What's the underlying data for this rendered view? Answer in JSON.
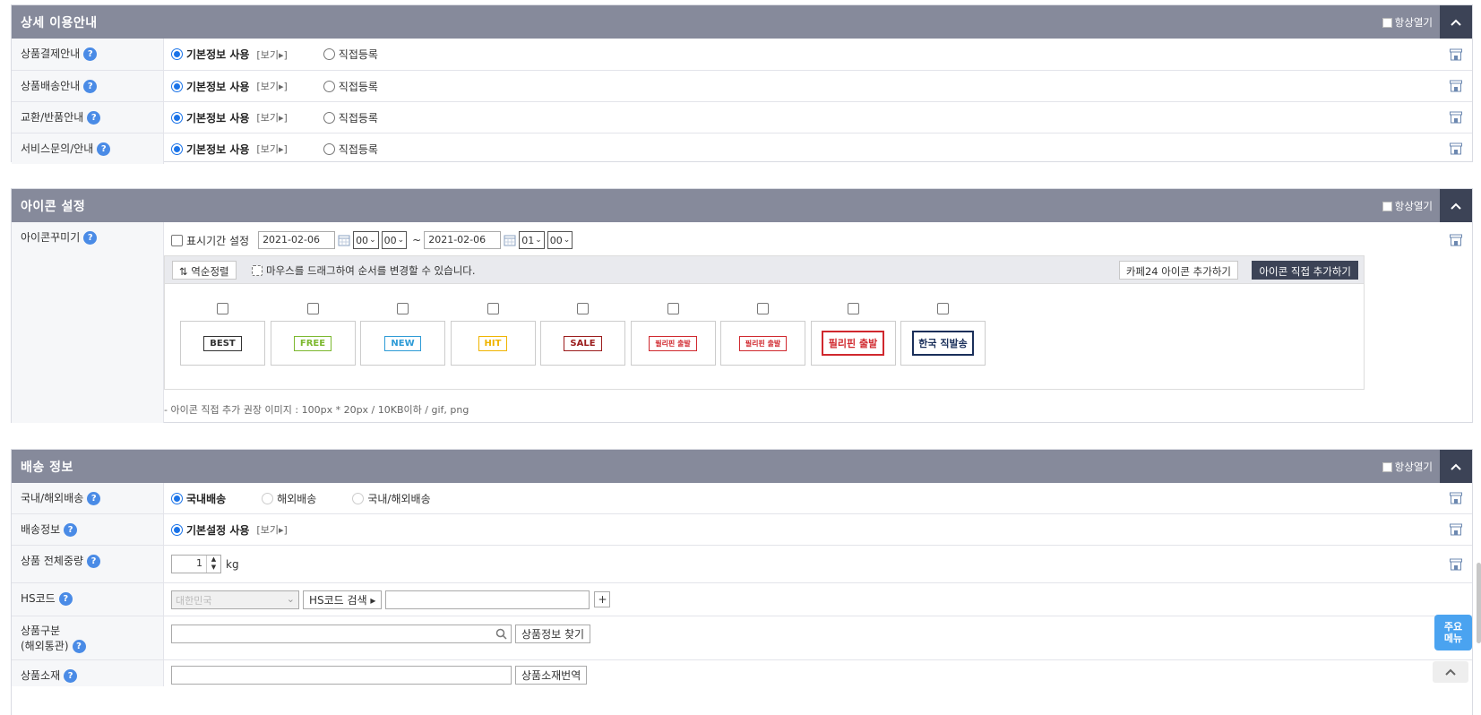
{
  "sections": {
    "detail": {
      "title": "상세 이용안내",
      "always_open": "항상열기",
      "rows": [
        {
          "label": "상품결제안내",
          "option_default": "기본정보 사용",
          "view": "[보기▸]",
          "option_custom": "직접등록"
        },
        {
          "label": "상품배송안내",
          "option_default": "기본정보 사용",
          "view": "[보기▸]",
          "option_custom": "직접등록"
        },
        {
          "label": "교환/반품안내",
          "option_default": "기본정보 사용",
          "view": "[보기▸]",
          "option_custom": "직접등록"
        },
        {
          "label": "서비스문의/안내",
          "option_default": "기본정보 사용",
          "view": "[보기▸]",
          "option_custom": "직접등록"
        }
      ]
    },
    "icon": {
      "title": "아이콘 설정",
      "always_open": "항상열기",
      "label": "아이콘꾸미기",
      "period_label": "표시기간 설정",
      "start_date": "2021-02-06",
      "start_hour": "00",
      "start_min": "00",
      "tilde": "~",
      "end_date": "2021-02-06",
      "end_hour": "01",
      "end_min": "00",
      "reverse_sort": "역순정렬",
      "drag_hint": "마우스를 드래그하여 순서를 변경할 수 있습니다.",
      "add_cafe24": "카페24 아이콘 추가하기",
      "add_direct": "아이콘 직접 추가하기",
      "icons": [
        {
          "text": "BEST",
          "color": "#333333"
        },
        {
          "text": "FREE",
          "color": "#7cb82f"
        },
        {
          "text": "NEW",
          "color": "#2e9bd6"
        },
        {
          "text": "HIT",
          "color": "#f0b400"
        },
        {
          "text": "SALE",
          "color": "#9b1c1c"
        },
        {
          "text": "필리핀 출발",
          "color": "#d0282e"
        },
        {
          "text": "필리핀 출발",
          "color": "#d0282e"
        },
        {
          "text": "필리핀 출발",
          "color": "#d0282e"
        },
        {
          "text": "한국 직발송",
          "color": "#1a2f5a"
        }
      ],
      "note": "- 아이콘 직접 추가 권장 이미지 : 100px * 20px / 10KB이하 / gif, png"
    },
    "shipping": {
      "title": "배송 정보",
      "always_open": "항상열기",
      "rows": {
        "ship_type": {
          "label": "국내/해외배송",
          "opt1": "국내배송",
          "opt2": "해외배송",
          "opt3": "국내/해외배송"
        },
        "ship_info": {
          "label": "배송정보",
          "opt1": "기본설정 사용",
          "view": "[보기▸]"
        },
        "weight": {
          "label": "상품 전체중량",
          "value": "1",
          "unit": "kg"
        },
        "hs": {
          "label": "HS코드",
          "country": "대한민국",
          "search_btn": "HS코드 검색 ▸",
          "plus": "+"
        },
        "category": {
          "label1": "상품구분",
          "label2": "(해외통관)",
          "find_btn": "상품정보 찾기"
        },
        "material": {
          "label": "상품소재",
          "translate_btn": "상품소재번역"
        }
      }
    }
  },
  "floating": {
    "main_menu_line1": "주요",
    "main_menu_line2": "메뉴"
  }
}
